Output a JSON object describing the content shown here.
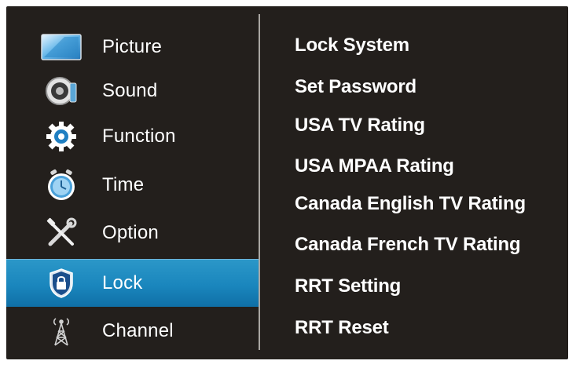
{
  "main_menu": {
    "items": [
      {
        "label": "Picture",
        "icon": "picture-icon"
      },
      {
        "label": "Sound",
        "icon": "speaker-icon"
      },
      {
        "label": "Function",
        "icon": "gear-icon"
      },
      {
        "label": "Time",
        "icon": "clock-icon"
      },
      {
        "label": "Option",
        "icon": "tools-icon"
      },
      {
        "label": "Lock",
        "icon": "lock-icon",
        "selected": true
      },
      {
        "label": "Channel",
        "icon": "antenna-icon"
      }
    ]
  },
  "lock_menu": {
    "items": [
      {
        "label": "Lock System"
      },
      {
        "label": "Set Password"
      },
      {
        "label": "USA TV Rating"
      },
      {
        "label": "USA MPAA Rating"
      },
      {
        "label": "Canada English TV Rating"
      },
      {
        "label": "Canada French TV Rating"
      },
      {
        "label": "RRT Setting"
      },
      {
        "label": "RRT Reset"
      }
    ]
  },
  "colors": {
    "background": "#231f1c",
    "highlight": "#1a86bd",
    "text": "#ffffff"
  }
}
